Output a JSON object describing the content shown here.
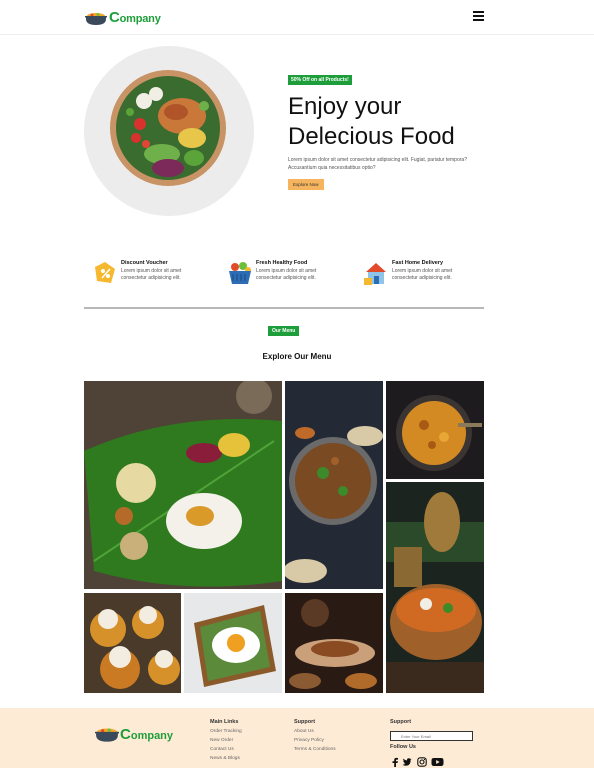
{
  "nav": {
    "brand_cap": "C",
    "brand_rest": "ompany",
    "menu_icon": "hamburger-menu-icon"
  },
  "hero": {
    "badge": "50% Off on all Products!",
    "title_line1": "Enjoy your",
    "title_line2": "Delecious Food",
    "description": "Lorem ipsum dolor sit amet consectetur adipisicing elit. Fugiat, pariatur tempora? Accusantium quia necessitatibus optio?",
    "button": "Explore Now"
  },
  "features": [
    {
      "icon": "discount-voucher-icon",
      "title": "Discount Voucher",
      "text": "Lorem ipsum dolor sit amet consectetur adipisicing elit."
    },
    {
      "icon": "healthy-food-basket-icon",
      "title": "Fresh Healthy Food",
      "text": "Lorem ipsum dolor sit amet consectetur adipisicing elit."
    },
    {
      "icon": "home-delivery-icon",
      "title": "Fast Home Delivery",
      "text": "Lorem ipsum dolor sit amet consectetur adipisicing elit."
    }
  ],
  "menu": {
    "badge": "Our Menu",
    "title": "Explore Our Menu"
  },
  "footer": {
    "brand_cap": "C",
    "brand_rest": "ompany",
    "main_links": {
      "heading": "Main Links",
      "items": [
        "Order Tracking",
        "New Order",
        "Contact Us",
        "News & Blogs"
      ]
    },
    "support_links": {
      "heading": "Support",
      "items": [
        "About Us",
        "Privacy Policy",
        "Terms & Conditions"
      ]
    },
    "newsletter": {
      "heading": "Support",
      "placeholder": "Enter Your Email"
    },
    "follow": "Follow Us",
    "socials": [
      "facebook-icon",
      "twitter-icon",
      "instagram-icon",
      "youtube-icon"
    ]
  },
  "colors": {
    "brand_green": "#1e9e3a",
    "button_orange": "#f5b45d",
    "footer_bg": "#fdebd5"
  }
}
